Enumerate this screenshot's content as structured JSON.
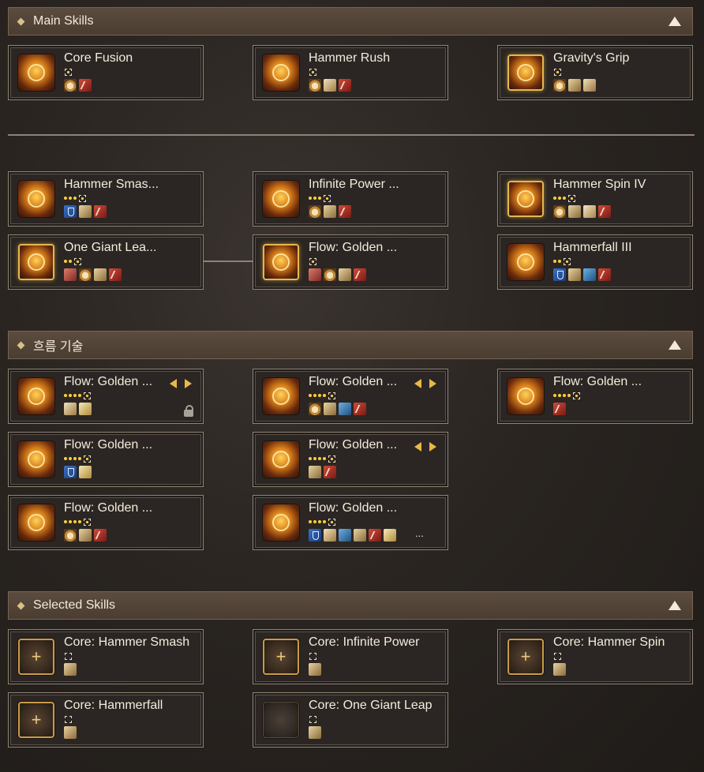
{
  "sections": {
    "main": {
      "title": "Main Skills"
    },
    "flow": {
      "title": "흐름 기술"
    },
    "selected": {
      "title": "Selected Skills"
    }
  },
  "main_skills": [
    {
      "name": "Core Fusion",
      "level_dots": 0,
      "tags": [
        "stagger-icon",
        "weak-point-icon"
      ]
    },
    {
      "name": "Hammer Rush",
      "level_dots": 0,
      "tags": [
        "stagger-icon",
        "counter-icon",
        "weak-point-icon"
      ]
    },
    {
      "name": "Gravity's Grip",
      "level_dots": 0,
      "tags": [
        "stagger-icon",
        "push-immunity-icon",
        "hand-icon"
      ]
    }
  ],
  "tree_skills": [
    {
      "name": "Hammer Smas...",
      "level_dots": 3,
      "tags": [
        "guard-icon",
        "push-immunity-icon",
        "weak-point-icon"
      ]
    },
    {
      "name": "Infinite Power ...",
      "level_dots": 3,
      "tags": [
        "stagger-icon",
        "push-immunity-icon",
        "weak-point-icon"
      ]
    },
    {
      "name": "Hammer Spin IV",
      "level_dots": 3,
      "tags": [
        "stagger-icon",
        "push-immunity-icon",
        "runner-icon",
        "weak-point-icon"
      ]
    },
    {
      "name": "One Giant Lea...",
      "level_dots": 2,
      "tags": [
        "part-break-icon",
        "stagger-icon",
        "push-immunity-icon",
        "weak-point-icon"
      ]
    },
    {
      "name": "Flow: Golden ...",
      "level_dots": 0,
      "tags": [
        "part-break-icon",
        "stagger-icon",
        "push-immunity-icon",
        "weak-point-icon"
      ]
    },
    {
      "name": "Hammerfall III",
      "level_dots": 2,
      "tags": [
        "guard-icon",
        "push-immunity-icon",
        "mobility-icon",
        "weak-point-icon"
      ]
    }
  ],
  "flow_skills": [
    {
      "name": "Flow: Golden ...",
      "level_dots": 4,
      "tags": [
        "counter-icon",
        "burst-icon"
      ],
      "arrows": true,
      "locked": true
    },
    {
      "name": "Flow: Golden ...",
      "level_dots": 4,
      "tags": [
        "stagger-icon",
        "push-immunity-icon",
        "mobility-icon",
        "weak-point-icon"
      ],
      "arrows": true,
      "locked": false
    },
    {
      "name": "Flow: Golden ...",
      "level_dots": 4,
      "tags": [
        "weak-point-icon"
      ],
      "arrows": false,
      "locked": false
    },
    {
      "name": "Flow: Golden ...",
      "level_dots": 4,
      "tags": [
        "guard-icon",
        "burst-icon"
      ],
      "arrows": false,
      "locked": false
    },
    {
      "name": "Flow: Golden ...",
      "level_dots": 4,
      "tags": [
        "push-immunity-icon",
        "weak-point-icon"
      ],
      "arrows": true,
      "locked": false
    },
    {
      "name": "Flow: Golden ...",
      "level_dots": 4,
      "tags": [
        "stagger-icon",
        "push-immunity-icon",
        "weak-point-icon"
      ],
      "arrows": false,
      "locked": false
    },
    {
      "name": "Flow: Golden ...",
      "level_dots": 4,
      "tags": [
        "guard-icon",
        "counter-icon",
        "mobility-icon",
        "push-immunity-icon",
        "weak-point-icon",
        "burst-icon"
      ],
      "arrows": false,
      "locked": false,
      "more": "..."
    }
  ],
  "selected_skills": [
    {
      "name": "Core: Hammer Smash",
      "tags": [
        "push-immunity-icon"
      ]
    },
    {
      "name": "Core: Infinite Power",
      "tags": [
        "push-immunity-icon"
      ]
    },
    {
      "name": "Core: Hammer Spin",
      "tags": [
        "push-immunity-icon"
      ]
    },
    {
      "name": "Core: Hammerfall",
      "tags": [
        "push-immunity-icon"
      ]
    },
    {
      "name": "Core: One Giant Leap",
      "tags": [
        "push-immunity-icon"
      ]
    }
  ]
}
